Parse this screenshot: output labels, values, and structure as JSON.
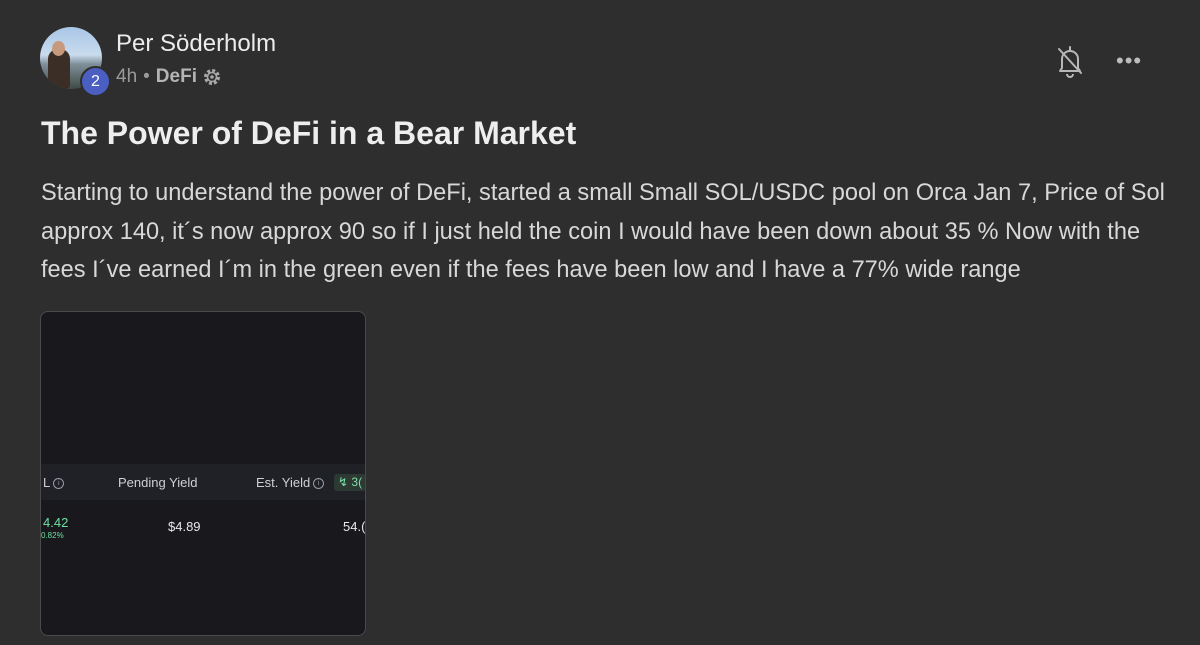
{
  "post": {
    "author": "Per Söderholm",
    "level_badge": "2",
    "time": "4h",
    "separator": "•",
    "community": "DeFi",
    "more_label": "•••",
    "title": "The Power of DeFi in a Bear Market",
    "body": "Starting to understand the power of DeFi, started a small Small SOL/USDC pool on Orca Jan 7, Price of Sol approx 140, it´s now approx 90 so if I just held the coin I would have been down about 35 % Now with the fees I´ve earned I´m in the green even if the fees have been low and I have a 77% wide range"
  },
  "attachment": {
    "col_partial": "L",
    "col_pending": "Pending Yield",
    "col_est": "Est. Yield",
    "chip": "3(",
    "val_pnl": "4.42",
    "val_pnl_pct": "0.82%",
    "val_pending": "$4.89",
    "val_est": "54.("
  },
  "colors": {
    "background": "#2e2e2e",
    "badge": "#4a5fc1",
    "positive": "#6fe0a0"
  }
}
